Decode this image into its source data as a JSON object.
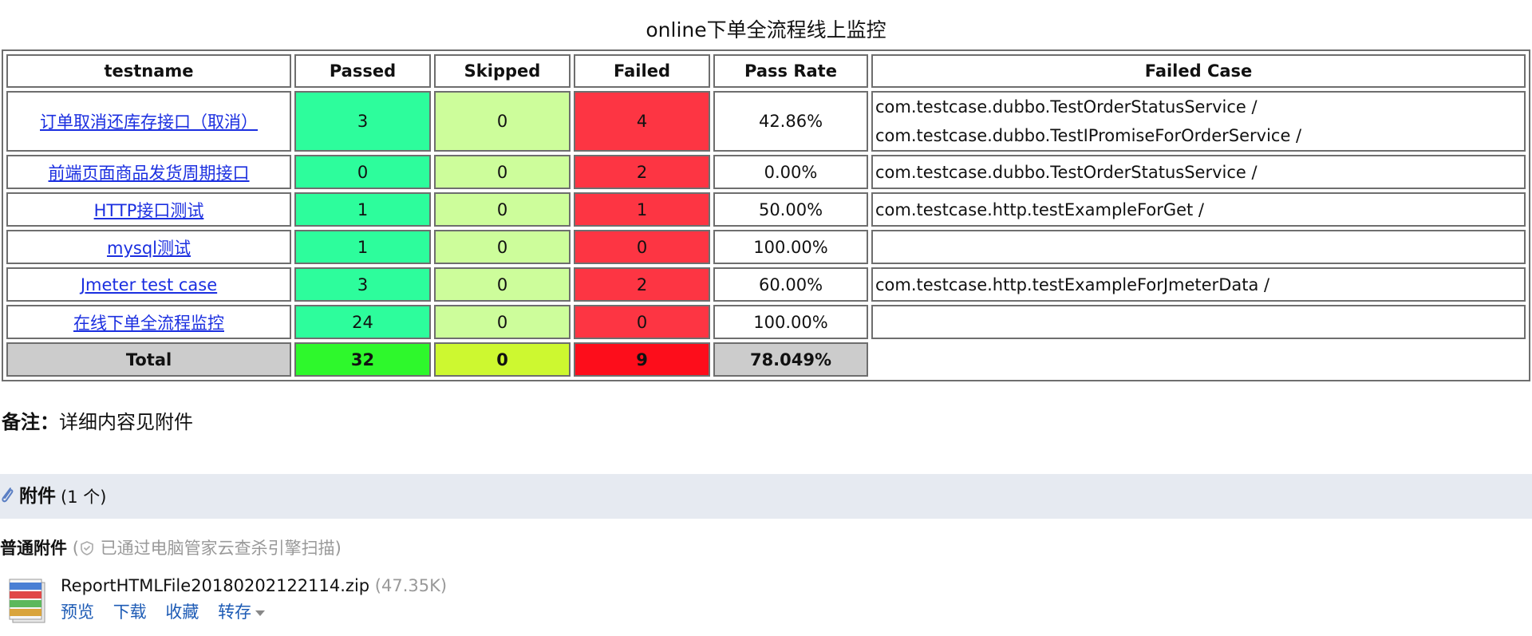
{
  "report": {
    "title": "online下单全流程线上监控",
    "headers": [
      "testname",
      "Passed",
      "Skipped",
      "Failed",
      "Pass Rate",
      "Failed Case"
    ],
    "rows": [
      {
        "name": "订单取消还库存接口（取消）",
        "passed": "3",
        "skipped": "0",
        "failed": "4",
        "rate": "42.86%",
        "cases": [
          "com.testcase.dubbo.TestOrderStatusService /",
          "com.testcase.dubbo.TestIPromiseForOrderService /"
        ]
      },
      {
        "name": "前端页面商品发货周期接口",
        "passed": "0",
        "skipped": "0",
        "failed": "2",
        "rate": "0.00%",
        "cases": [
          "com.testcase.dubbo.TestOrderStatusService /"
        ]
      },
      {
        "name": "HTTP接口测试",
        "passed": "1",
        "skipped": "0",
        "failed": "1",
        "rate": "50.00%",
        "cases": [
          "com.testcase.http.testExampleForGet /"
        ]
      },
      {
        "name": "mysql测试",
        "passed": "1",
        "skipped": "0",
        "failed": "0",
        "rate": "100.00%",
        "cases": [
          ""
        ]
      },
      {
        "name": "Jmeter test case",
        "passed": "3",
        "skipped": "0",
        "failed": "2",
        "rate": "60.00%",
        "cases": [
          "com.testcase.http.testExampleForJmeterData /"
        ]
      },
      {
        "name": "在线下单全流程监控",
        "passed": "24",
        "skipped": "0",
        "failed": "0",
        "rate": "100.00%",
        "cases": [
          ""
        ]
      }
    ],
    "total": {
      "label": "Total",
      "passed": "32",
      "skipped": "0",
      "failed": "9",
      "rate": "78.049%"
    }
  },
  "note": {
    "label": "备注：",
    "text": "详细内容见附件"
  },
  "attachments": {
    "title": "附件",
    "count": "(1 个)",
    "normal_label": "普通附件",
    "scan_text": "已通过电脑管家云查杀引擎扫描)",
    "scan_prefix": "(",
    "file": {
      "name": "ReportHTMLFile20180202122114.zip",
      "size": "(47.35K)"
    },
    "actions": {
      "preview": "预览",
      "download": "下载",
      "favorite": "收藏",
      "save": "转存"
    }
  },
  "colors": {
    "passed": "#2dfd9c",
    "skipped": "#cdfd9b",
    "failed": "#fd3543",
    "total_passed": "#2ef82c",
    "total_skipped": "#cdf830",
    "total_failed": "#fd0d1b",
    "total_gray": "#cccccc",
    "link": "#1b2fe0",
    "action_link": "#1d5bb5",
    "attach_bar": "#e6eaf1"
  }
}
